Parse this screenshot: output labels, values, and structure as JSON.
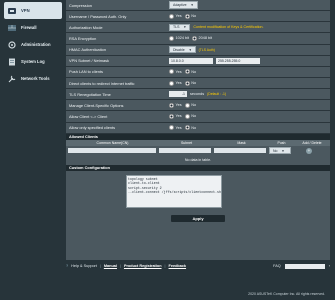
{
  "sidebar": {
    "items": [
      {
        "label": "VPN",
        "icon": "vpn-icon",
        "active": true
      },
      {
        "label": "Firewall",
        "icon": "firewall-icon",
        "active": false
      },
      {
        "label": "Administration",
        "icon": "administration-icon",
        "active": false
      },
      {
        "label": "System Log",
        "icon": "system-log-icon",
        "active": false
      },
      {
        "label": "Network Tools",
        "icon": "network-tools-icon",
        "active": false
      }
    ]
  },
  "settings": {
    "compression": {
      "label": "Compression",
      "value": "Adaptive"
    },
    "username_auth": {
      "label": "Username / Password Auth. Only",
      "yes": "Yes",
      "no": "No"
    },
    "auth_mode": {
      "label": "Authorization Mode",
      "value": "TLS",
      "link": "Content modification of Keys & Certification."
    },
    "rsa": {
      "label": "RSA Encryption",
      "opt1": "1024 bit",
      "opt2": "2048 bit"
    },
    "hmac": {
      "label": "HMAC Authentication",
      "value": "Disable",
      "note": "(TLS Auth)"
    },
    "subnet": {
      "label": "VPN Subnet / Netmask",
      "ip": "10.8.0.0",
      "mask": "255.255.255.0"
    },
    "push_lan": {
      "label": "Push LAN to clients",
      "yes": "Yes",
      "no": "No"
    },
    "redirect": {
      "label": "Direct clients to redirect Internet traffic",
      "yes": "Yes",
      "no": "No"
    },
    "tls_reneg": {
      "label": "TLS Renegotiation Time",
      "value": "-1",
      "unit": "seconds",
      "note": "(Default : -1)"
    },
    "manage_opts": {
      "label": "Manage Client-Specific Options",
      "yes": "Yes",
      "no": "No"
    },
    "c2c": {
      "label": "Allow Client <-> Client",
      "yes": "Yes",
      "no": "No"
    },
    "only_specified": {
      "label": "Allow only specified clients",
      "yes": "Yes",
      "no": "No"
    }
  },
  "allowed_clients": {
    "title": "Allowed Clients",
    "headers": [
      "Common Name(CN)",
      "Subnet",
      "Mask",
      "Push",
      "Add / Delete"
    ],
    "push_value": "No",
    "empty_text": "No data in table."
  },
  "custom_config": {
    "title": "Custom Configuration",
    "content": "topology subnet\nclient-to-client\nscript-security 2\n--client-connect /jffs/scripts/clientconnect.sh"
  },
  "apply_label": "Apply",
  "footer": {
    "help": "Help & Support",
    "manual": "Manual",
    "registration": "Product Registration",
    "feedback": "Feedback",
    "faq": "FAQ",
    "copyright": "2020 ASUSTeK Computer Inc. All rights reserved."
  }
}
